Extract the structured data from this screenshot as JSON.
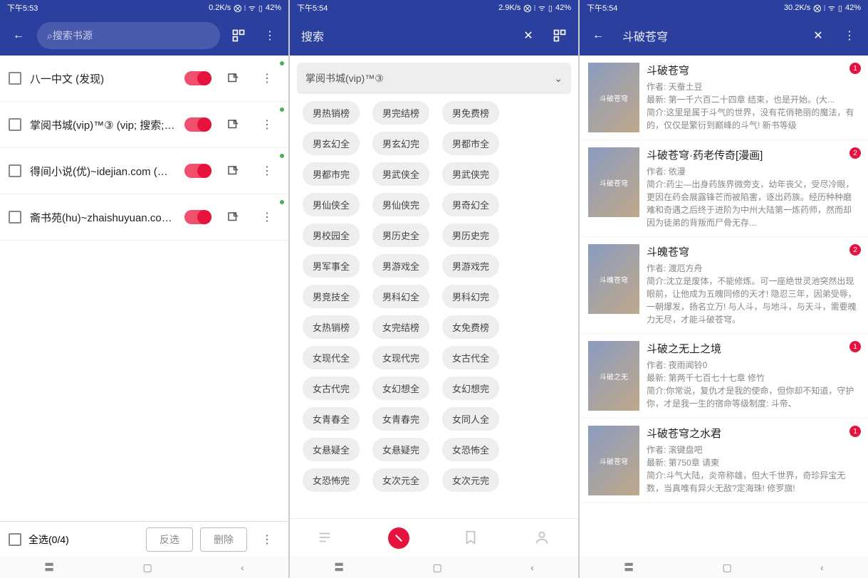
{
  "screen1": {
    "status": {
      "time": "下午5:53",
      "speed": "0.2K/s",
      "battery": "42%"
    },
    "header": {
      "search_placeholder": "搜索书源"
    },
    "sources": [
      {
        "name": "八一中文 (发现)"
      },
      {
        "name": "掌阅书城(vip)™③ (vip; 搜索; 发..."
      },
      {
        "name": "得间小说(优)~idejian.com (搜..."
      },
      {
        "name": "斋书苑(hu)~zhaishuyuan.com..."
      }
    ],
    "footer": {
      "select_all": "全选(0/4)",
      "invert": "反选",
      "delete": "删除"
    }
  },
  "screen2": {
    "status": {
      "time": "下午5:54",
      "speed": "2.9K/s",
      "battery": "42%"
    },
    "header": {
      "search_label": "搜索"
    },
    "dropdown": "掌阅书城(vip)™③",
    "tags": [
      "男热销榜",
      "男完结榜",
      "男免费榜",
      "男玄幻全",
      "男玄幻完",
      "男都市全",
      "男都市完",
      "男武侠全",
      "男武侠完",
      "男仙侠全",
      "男仙侠完",
      "男奇幻全",
      "男校园全",
      "男历史全",
      "男历史完",
      "男军事全",
      "男游戏全",
      "男游戏完",
      "男竞技全",
      "男科幻全",
      "男科幻完",
      "女热销榜",
      "女完结榜",
      "女免费榜",
      "女现代全",
      "女现代完",
      "女古代全",
      "女古代完",
      "女幻想全",
      "女幻想完",
      "女青春全",
      "女青春完",
      "女同人全",
      "女悬疑全",
      "女悬疑完",
      "女恐怖全",
      "女恐怖完",
      "女次元全",
      "女次元完"
    ]
  },
  "screen3": {
    "status": {
      "time": "下午5:54",
      "speed": "30.2K/s",
      "battery": "42%"
    },
    "header": {
      "query": "斗破苍穹"
    },
    "books": [
      {
        "title": "斗破苍穹",
        "author": "作者: 天蚕土豆",
        "latest": "最新: 第一千六百二十四章 结束，也是开始。(大...",
        "desc": "简介:这里是属于斗气的世界，没有花俏艳丽的魔法，有的，仅仅是繁衍到巅峰的斗气! 新书等级",
        "badge": "1"
      },
      {
        "title": "斗破苍穹·药老传奇[漫画]",
        "author": "作者: 依漫",
        "desc": "简介:药尘—出身药族界微旁支，幼年丧父，受尽冷眼，更因在药会展露锋芒而被陷害，逐出药族。经历种种磨难和奇遇之后终于进阶为中州大陆第一炼药师，然而却因为徒弟的背叛而尸骨无存...",
        "badge": "2"
      },
      {
        "title": "斗魄苍穹",
        "author": "作者: 渡厄方舟",
        "desc": "简介:沈立是废体，不能修炼。可一座绝世灵池突然出现眼前，让他成为五魄同修的天才! 隐忍三年，因弟受辱，一朝爆发，扬名立万! 与人斗，与地斗，与天斗，需要魄力无尽，才能斗破苍穹。",
        "badge": "2"
      },
      {
        "title": "斗破之无上之境",
        "author": "作者: 夜雨闻铃0",
        "latest": "最新: 第两千七百七十七章 修竹",
        "desc": "简介:你常说，复仇才是我的使命，但你却不知道，守护你，才是我一生的宿命等级制度: 斗帝、",
        "badge": "1"
      },
      {
        "title": "斗破苍穹之水君",
        "author": "作者: 滚键盘吧",
        "latest": "最新: 第750章 请柬",
        "desc": "简介:斗气大陆，炎帝称雄，但大千世界，奇珍异宝无数，当真唯有异火无敌?定海珠! 修罗旗!",
        "badge": "1"
      }
    ]
  }
}
